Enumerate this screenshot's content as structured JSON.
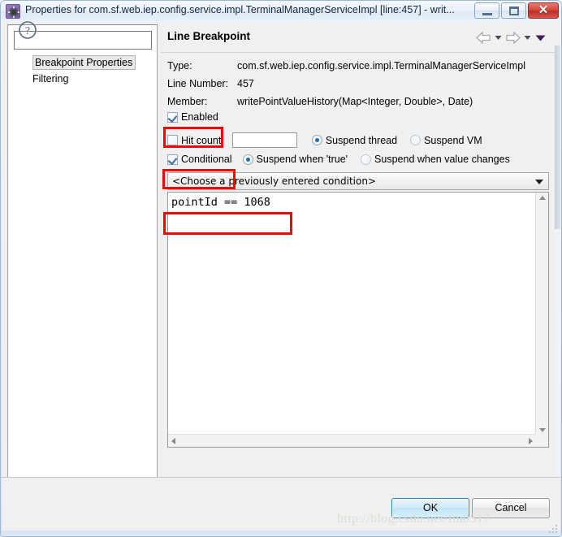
{
  "window": {
    "title": "Properties for com.sf.web.iep.config.service.impl.TerminalManagerServiceImpl [line:457] - writ...",
    "icon": "gear-icon",
    "minimize_label": "",
    "maximize_label": "",
    "close_label": "✕"
  },
  "sidebar": {
    "filter_placeholder": "",
    "filter_value": "",
    "items": [
      {
        "label": "Breakpoint Properties",
        "selected": true
      },
      {
        "label": "Filtering",
        "selected": false
      }
    ]
  },
  "main": {
    "title": "Line Breakpoint",
    "nav": {
      "back_icon": "arrow-left-icon",
      "back_menu_icon": "chevron-down-icon",
      "forward_icon": "arrow-right-icon",
      "forward_menu_icon": "chevron-down-icon",
      "page_menu_icon": "chevron-down-filled-icon"
    },
    "fields": [
      {
        "label": "Type:",
        "value": "com.sf.web.iep.config.service.impl.TerminalManagerServiceImpl"
      },
      {
        "label": "Line Number:",
        "value": "457"
      },
      {
        "label": "Member:",
        "value": "writePointValueHistory(Map<Integer, Double>, Date)"
      }
    ],
    "enabled": {
      "label": "Enabled",
      "checked": true
    },
    "hit_count": {
      "label": "Hit count:",
      "checked": false,
      "value": ""
    },
    "suspend_thread": {
      "label": "Suspend thread",
      "selected": true
    },
    "suspend_vm": {
      "label": "Suspend VM",
      "selected": false
    },
    "conditional": {
      "label": "Conditional",
      "checked": true
    },
    "suspend_when_true": {
      "label": "Suspend when 'true'",
      "selected": true
    },
    "suspend_when_changes": {
      "label": "Suspend when value changes",
      "selected": false
    },
    "condition_combo": {
      "value": "<Choose a previously entered condition>",
      "arrow_icon": "chevron-down-icon"
    },
    "condition_code": "pointId == 1068",
    "scroll_up_icon": "triangle-up-icon",
    "scroll_down_icon": "triangle-down-icon",
    "scroll_left_icon": "triangle-left-icon",
    "scroll_right_icon": "triangle-right-icon"
  },
  "footer": {
    "help_icon": "question-mark-icon",
    "ok_label": "OK",
    "cancel_label": "Cancel"
  },
  "watermark": "http://blog.csdn.net/fm0517",
  "colors": {
    "annotation": "#fe0000",
    "accent": "#1d6fb8",
    "close_button": "#d3453c",
    "dialog_bg": "#f0f0f0"
  }
}
